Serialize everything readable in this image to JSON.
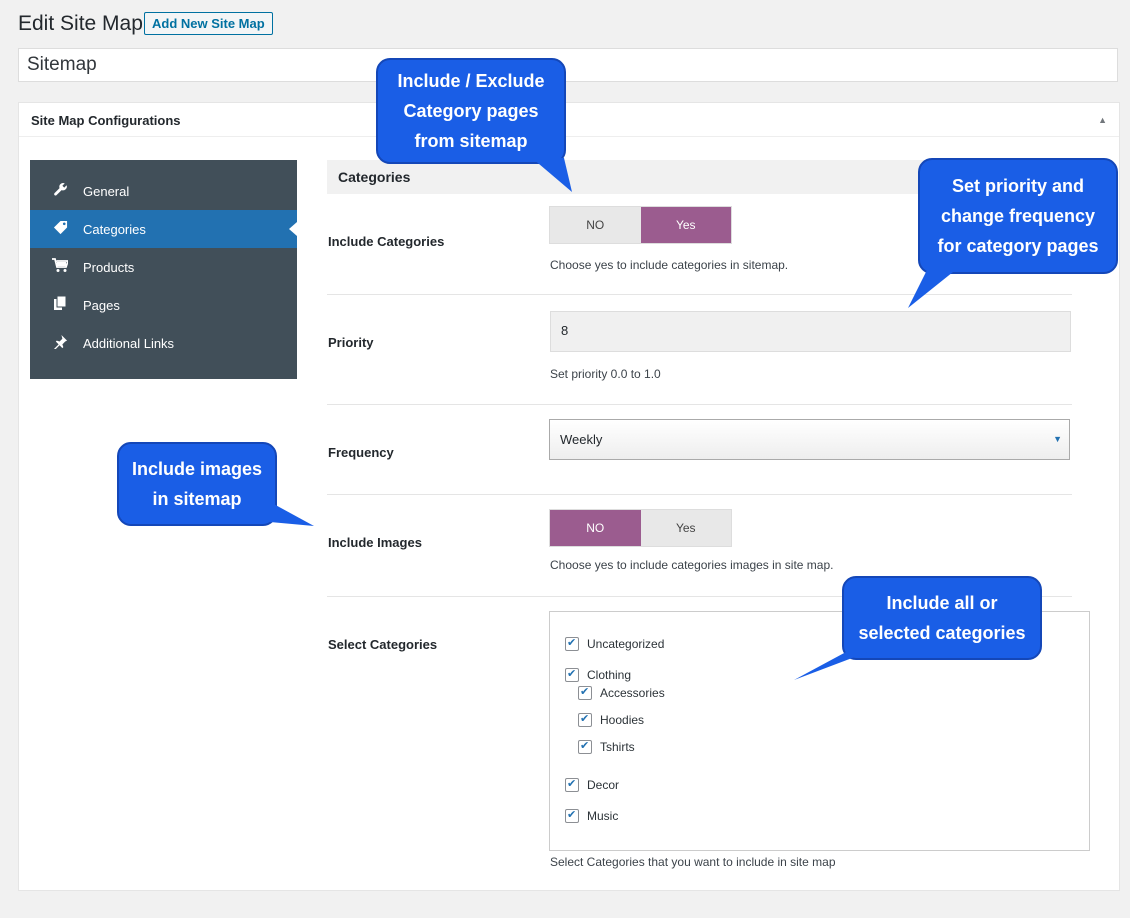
{
  "header": {
    "title": "Edit Site Map",
    "add_new_label": "Add New Site Map",
    "title_value": "Sitemap"
  },
  "postbox": {
    "title": "Site Map Configurations",
    "toggle_icon": "caret-up-icon"
  },
  "sidebar": {
    "items": [
      {
        "label": "General",
        "icon": "wrench-icon"
      },
      {
        "label": "Categories",
        "icon": "tag-icon",
        "active": true
      },
      {
        "label": "Products",
        "icon": "cart-icon"
      },
      {
        "label": "Pages",
        "icon": "pages-icon"
      },
      {
        "label": "Additional Links",
        "icon": "pin-icon"
      }
    ]
  },
  "section": {
    "title": "Categories",
    "include_categories": {
      "label": "Include Categories",
      "no_label": "NO",
      "yes_label": "Yes",
      "selected": "Yes",
      "help": "Choose yes to include categories in sitemap."
    },
    "priority": {
      "label": "Priority",
      "value": "8",
      "help": "Set priority 0.0 to 1.0"
    },
    "frequency": {
      "label": "Frequency",
      "value": "Weekly"
    },
    "include_images": {
      "label": "Include Images",
      "no_label": "NO",
      "yes_label": "Yes",
      "selected": "NO",
      "help": "Choose yes to include categories images in site map."
    },
    "select_categories": {
      "label": "Select Categories",
      "items": [
        {
          "label": "Uncategorized",
          "checked": true
        },
        {
          "label": "Clothing",
          "checked": true
        },
        {
          "label": "Accessories",
          "checked": true
        },
        {
          "label": "Hoodies",
          "checked": true
        },
        {
          "label": "Tshirts",
          "checked": true
        },
        {
          "label": "Decor",
          "checked": true
        },
        {
          "label": "Music",
          "checked": true
        }
      ],
      "help": "Select Categories that you want to include in site map"
    }
  },
  "callouts": {
    "include_exclude": [
      "Include / Exclude",
      "Category pages",
      "from sitemap"
    ],
    "priority": [
      "Set priority and",
      "change frequency",
      "for category pages"
    ],
    "images": [
      "Include images",
      "in sitemap"
    ],
    "categories": [
      "Include all or",
      "selected categories"
    ]
  },
  "colors": {
    "accent": "#2271b1",
    "switch_on": "#9b5c8f",
    "sidebar_bg": "#414f59",
    "callout": "#1a5ee6"
  }
}
